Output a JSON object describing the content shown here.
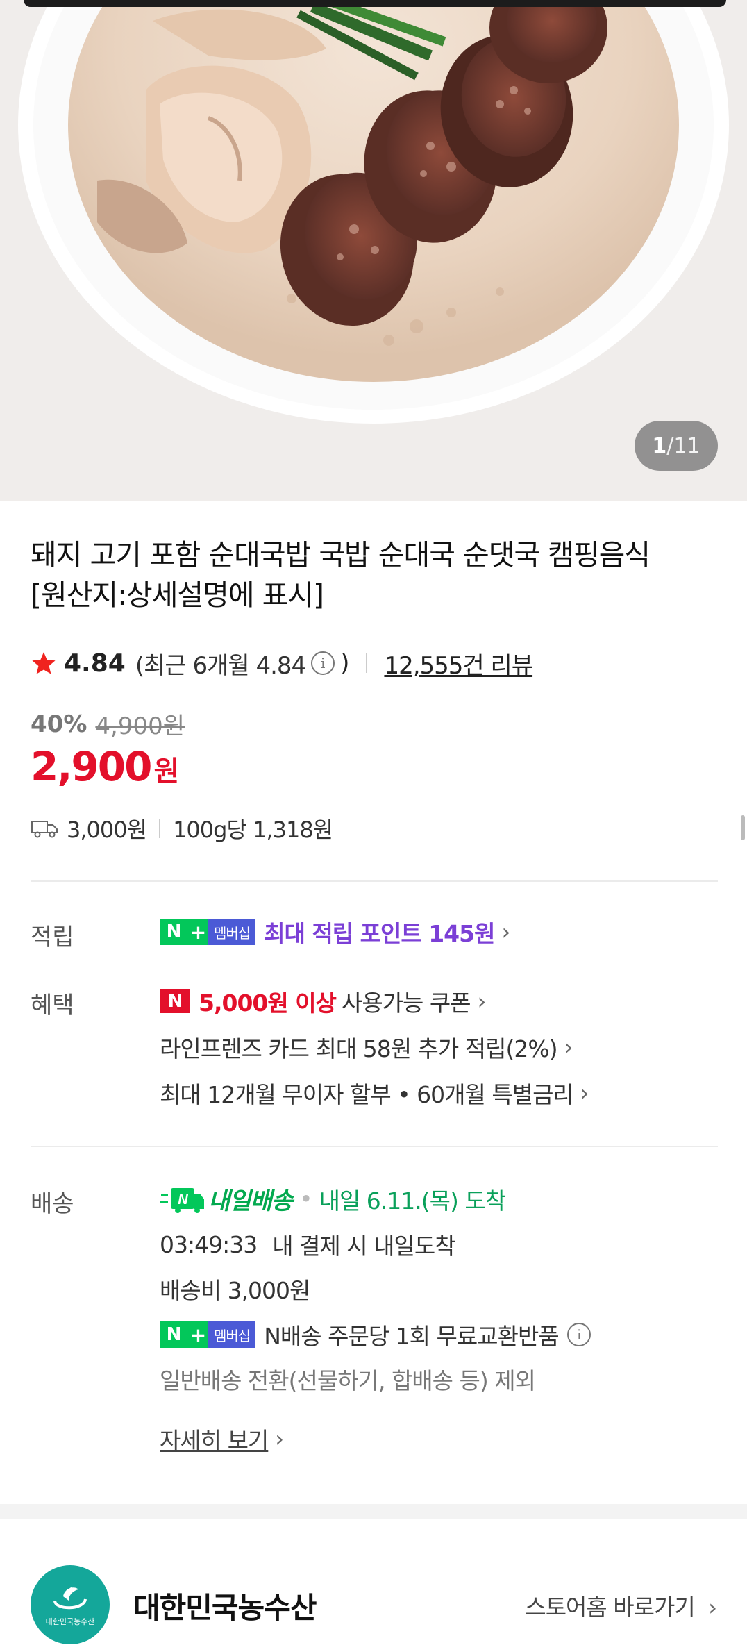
{
  "gallery": {
    "current": "1",
    "separator": "/",
    "total": "11"
  },
  "product": {
    "title_line1": "돼지 고기 포함 순대국밥 국밥 순대국 순댓국 캠핑음식",
    "title_line2": "[원산지:상세설명에 표시]",
    "rating": "4.84",
    "recent_rating": "(최근 6개월 4.84",
    "recent_rating_close": ")",
    "review_count": "12,555건 리뷰",
    "discount_pct": "40%",
    "original_price": "4,900원",
    "price": "2,900",
    "currency": "원",
    "shipping_fee": "3,000원",
    "unit_price": "100g당 1,318원"
  },
  "points": {
    "label": "적립",
    "badge_n": "N",
    "badge_plus": "+",
    "badge_member": "멤버십",
    "text": "최대 적립 포인트 145원"
  },
  "benefits": {
    "label": "혜택",
    "coupon_badge": "N",
    "coupon_highlight": "5,000원 이상",
    "coupon_text": "사용가능 쿠폰",
    "card": "라인프렌즈 카드 최대 58원 추가 적립(2%)",
    "installment": "최대 12개월 무이자 할부 • 60개월 특별금리"
  },
  "delivery": {
    "label": "배송",
    "badge_n": "N",
    "badge_text": "내일배송",
    "arrival": "내일 6.11.(목) 도착",
    "countdown": "03:49:33",
    "countdown_text": "내 결제 시 내일도착",
    "fee": "배송비 3,000원",
    "membership_text": "N배송 주문당 1회 무료교환반품",
    "exclusion": "일반배송 전환(선물하기, 합배송 등) 제외",
    "detail_link": "자세히 보기"
  },
  "store": {
    "name": "대한민국농수산",
    "logo_text": "대한민국농수산",
    "home_link": "스토어홈 바로가기"
  },
  "colors": {
    "price_red": "#e3102b",
    "naver_green": "#03c75a",
    "points_purple": "#7b3fd6"
  }
}
